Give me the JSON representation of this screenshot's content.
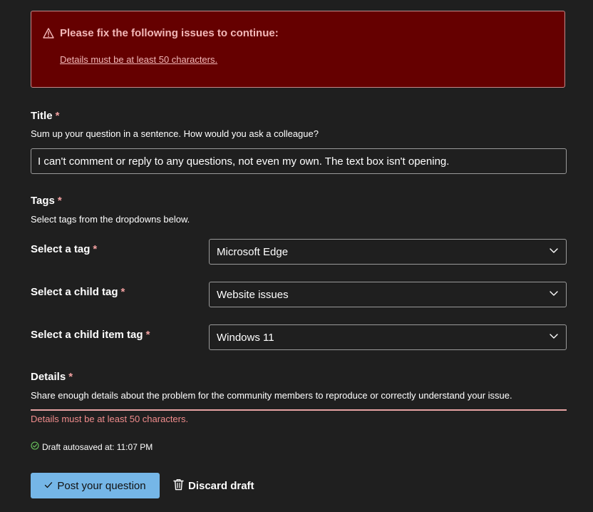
{
  "error_banner": {
    "heading": "Please fix the following issues to continue:",
    "link": "Details must be at least 50 characters."
  },
  "title_field": {
    "label": "Title",
    "required_mark": "*",
    "hint": "Sum up your question in a sentence. How would you ask a colleague?",
    "value": "I can't comment or reply to any questions, not even my own. The text box isn't opening."
  },
  "tags": {
    "label": "Tags",
    "required_mark": "*",
    "hint": "Select tags from the dropdowns below.",
    "selects": [
      {
        "label": "Select a tag",
        "required_mark": "*",
        "value": "Microsoft Edge"
      },
      {
        "label": "Select a child tag",
        "required_mark": "*",
        "value": "Website issues"
      },
      {
        "label": "Select a child item tag",
        "required_mark": "*",
        "value": "Windows 11"
      }
    ]
  },
  "details": {
    "label": "Details",
    "required_mark": "*",
    "hint": "Share enough details about the problem for the community members to reproduce or correctly understand your issue.",
    "error": "Details must be at least 50 characters."
  },
  "autosave": {
    "text": "Draft autosaved at: 11:07 PM"
  },
  "actions": {
    "post_label": "Post your question",
    "discard_label": "Discard draft"
  },
  "colors": {
    "background": "#1f1f1f",
    "error_banner": "#650000",
    "error_text": "#f2b8b8",
    "primary_button": "#75b6e7",
    "success": "#6ccb5f"
  }
}
